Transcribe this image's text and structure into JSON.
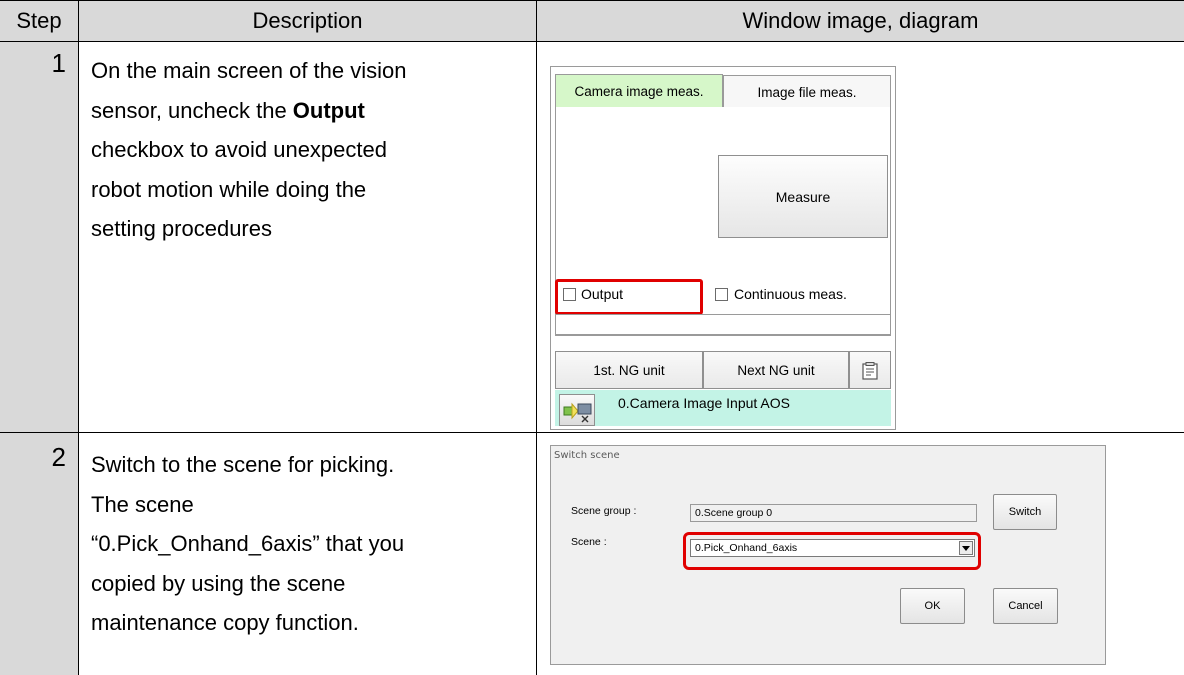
{
  "table": {
    "headers": {
      "step": "Step",
      "description": "Description",
      "window": "Window image, diagram"
    },
    "rows": [
      {
        "step": "1",
        "description_lines": [
          "On the main screen of the vision",
          "sensor, uncheck the ",
          "Output",
          "checkbox to avoid unexpected",
          "robot motion while doing the",
          "setting procedures"
        ]
      },
      {
        "step": "2",
        "description_lines": [
          "Switch to the scene for picking.",
          "The scene",
          "“0.Pick_Onhand_6axis” that you",
          "copied by using the scene",
          "maintenance copy function."
        ]
      }
    ]
  },
  "sensor_panel": {
    "tab_active": "Camera image meas.",
    "tab_inactive": "Image file meas.",
    "measure_button": "Measure",
    "output_label": "Output",
    "output_checked": false,
    "continuous_label": "Continuous meas.",
    "continuous_checked": false,
    "first_ng_button": "1st. NG unit",
    "next_ng_button": "Next NG unit",
    "unit_label": "0.Camera Image Input AOS",
    "highlight_color": "#e00000",
    "active_tab_color": "#d6f7c9",
    "unit_row_color": "#c3f3e6"
  },
  "switch_dialog": {
    "title": "Switch scene",
    "scene_group_label": "Scene group :",
    "scene_group_value": "0.Scene group 0",
    "scene_label": "Scene :",
    "scene_value": "0.Pick_Onhand_6axis",
    "switch_button": "Switch",
    "ok_button": "OK",
    "cancel_button": "Cancel"
  }
}
